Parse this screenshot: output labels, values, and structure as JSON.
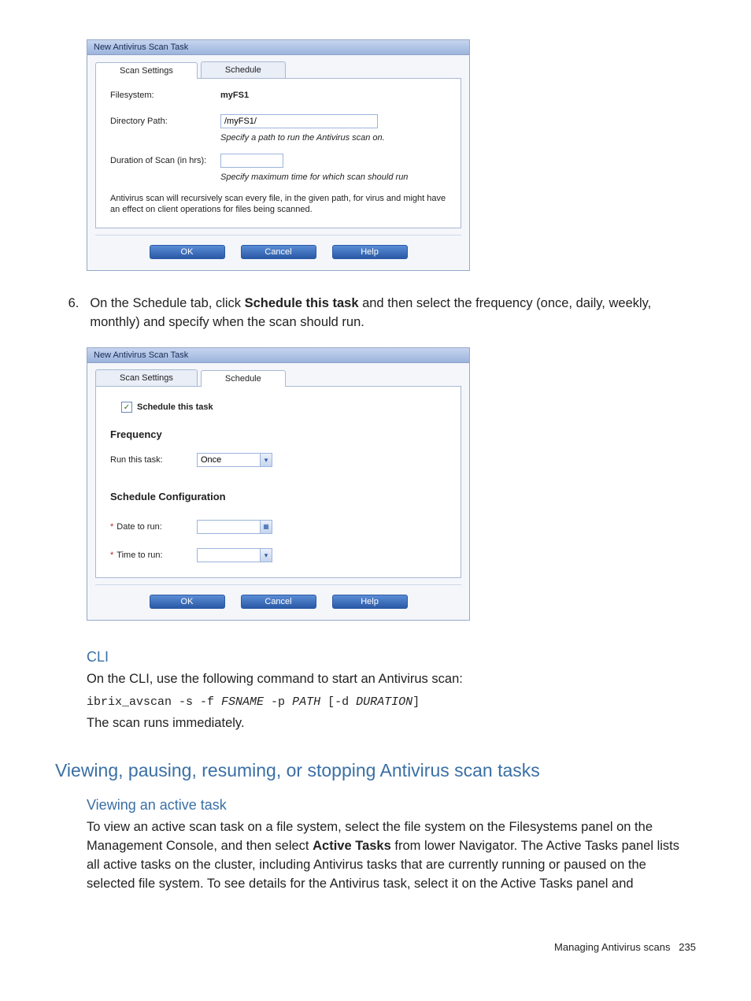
{
  "dlg1": {
    "title": "New Antivirus Scan Task",
    "tabs": {
      "scan": "Scan Settings",
      "schedule": "Schedule"
    },
    "filesystem_label": "Filesystem:",
    "filesystem_value": "myFS1",
    "dirpath_label": "Directory Path:",
    "dirpath_value": "/myFS1/",
    "dirpath_hint": "Specify a path to run the Antivirus scan on.",
    "duration_label": "Duration of Scan (in hrs):",
    "duration_value": "",
    "duration_hint": "Specify maximum time for which scan should run",
    "note": "Antivirus scan will recursively scan every file, in the given path, for virus and might have an effect on client operations for files being scanned.",
    "buttons": {
      "ok": "OK",
      "cancel": "Cancel",
      "help": "Help"
    }
  },
  "step6": {
    "num": "6.",
    "text_a": "On the Schedule tab, click ",
    "bold": "Schedule this task",
    "text_b": " and then select the frequency (once, daily, weekly, monthly) and specify when the scan should run."
  },
  "dlg2": {
    "title": "New Antivirus Scan Task",
    "tabs": {
      "scan": "Scan Settings",
      "schedule": "Schedule"
    },
    "schedule_checkbox_label": "Schedule this task",
    "frequency_hdr": "Frequency",
    "run_label": "Run this task:",
    "run_value": "Once",
    "schedcfg_hdr": "Schedule Configuration",
    "date_label": "Date to run:",
    "date_value": "",
    "time_label": "Time to run:",
    "time_value": "",
    "buttons": {
      "ok": "OK",
      "cancel": "Cancel",
      "help": "Help"
    }
  },
  "cli": {
    "heading": "CLI",
    "intro": "On the CLI, use the following command to start an Antivirus scan:",
    "cmd_prefix": "ibrix_avscan -s -f ",
    "cmd_arg1": "FSNAME",
    "cmd_mid": " -p ",
    "cmd_arg2": "PATH",
    "cmd_open": " [-d ",
    "cmd_arg3": "DURATION",
    "cmd_close": "]",
    "outro": "The scan runs immediately."
  },
  "viewing": {
    "h2": "Viewing, pausing, resuming, or stopping Antivirus scan tasks",
    "h3": "Viewing an active task",
    "para_a": "To view an active scan task on a file system, select the file system on the Filesystems panel on the Management Console, and then select ",
    "para_bold": "Active Tasks",
    "para_b": " from lower Navigator. The Active Tasks panel lists all active tasks on the cluster, including Antivirus tasks that are currently running or paused on the selected file system. To see details for the Antivirus task, select it on the Active Tasks panel and"
  },
  "footer": {
    "text": "Managing Antivirus scans",
    "page": "235"
  }
}
